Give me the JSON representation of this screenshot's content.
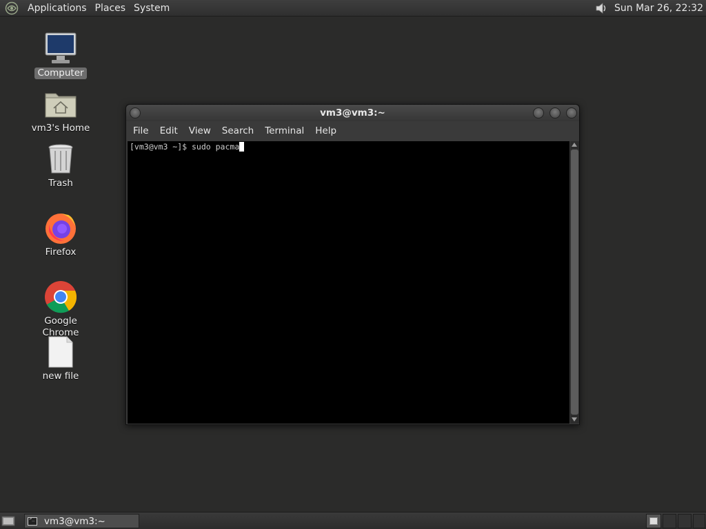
{
  "top_panel": {
    "menus": [
      "Applications",
      "Places",
      "System"
    ],
    "clock": "Sun Mar 26, 22:32"
  },
  "desktop": {
    "icons": [
      {
        "label": "Computer",
        "icon": "computer-icon"
      },
      {
        "label": "vm3's Home",
        "icon": "home-folder-icon"
      },
      {
        "label": "Trash",
        "icon": "trash-icon"
      },
      {
        "label": "Firefox",
        "icon": "firefox-icon"
      },
      {
        "label": "Google Chrome",
        "icon": "chrome-icon"
      },
      {
        "label": "new file",
        "icon": "file-icon"
      }
    ]
  },
  "window": {
    "title": "vm3@vm3:~",
    "menus": [
      "File",
      "Edit",
      "View",
      "Search",
      "Terminal",
      "Help"
    ],
    "prompt_line": "[vm3@vm3 ~]$ sudo pacma"
  },
  "taskbar": {
    "task_label": "vm3@vm3:~"
  }
}
